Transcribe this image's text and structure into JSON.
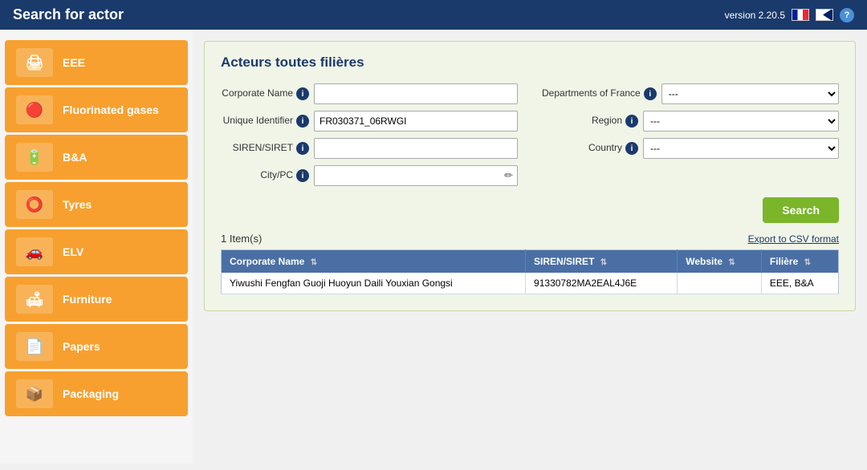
{
  "topbar": {
    "title": "Search for actor",
    "version": "version 2.20.5",
    "help_label": "?"
  },
  "sidebar": {
    "items": [
      {
        "id": "eee",
        "label": "EEE",
        "icon": "🖨"
      },
      {
        "id": "fluorinated",
        "label": "Fluorinated gases",
        "icon": "🔴"
      },
      {
        "id": "bna",
        "label": "B&A",
        "icon": "🔋"
      },
      {
        "id": "tyres",
        "label": "Tyres",
        "icon": "⭕"
      },
      {
        "id": "elv",
        "label": "ELV",
        "icon": "🚗"
      },
      {
        "id": "furniture",
        "label": "Furniture",
        "icon": "🛋"
      },
      {
        "id": "papers",
        "label": "Papers",
        "icon": "📄"
      },
      {
        "id": "packaging",
        "label": "Packaging",
        "icon": "📦"
      }
    ]
  },
  "panel": {
    "title": "Acteurs toutes filières"
  },
  "form": {
    "corporate_name_label": "Corporate Name",
    "unique_identifier_label": "Unique Identifier",
    "siren_siret_label": "SIREN/SIRET",
    "city_pc_label": "City/PC",
    "departments_france_label": "Departments of France",
    "region_label": "Region",
    "country_label": "Country",
    "corporate_name_value": "",
    "unique_identifier_value": "FR030371_06RWGI",
    "siren_siret_value": "",
    "city_pc_value": "",
    "departments_default": "---",
    "region_default": "---",
    "country_default": "---",
    "search_button_label": "Search"
  },
  "results": {
    "count_label": "1 Item(s)",
    "export_label": "Export to CSV format",
    "columns": [
      {
        "key": "corporate_name",
        "label": "Corporate Name"
      },
      {
        "key": "siren_siret",
        "label": "SIREN/SIRET"
      },
      {
        "key": "website",
        "label": "Website"
      },
      {
        "key": "filiere",
        "label": "Filière"
      }
    ],
    "rows": [
      {
        "corporate_name": "Yiwushi Fengfan Guoji Huoyun Daili Youxian Gongsi",
        "siren_siret": "91330782MA2EAL4J6E",
        "website": "",
        "filiere": "EEE, B&A"
      }
    ]
  }
}
